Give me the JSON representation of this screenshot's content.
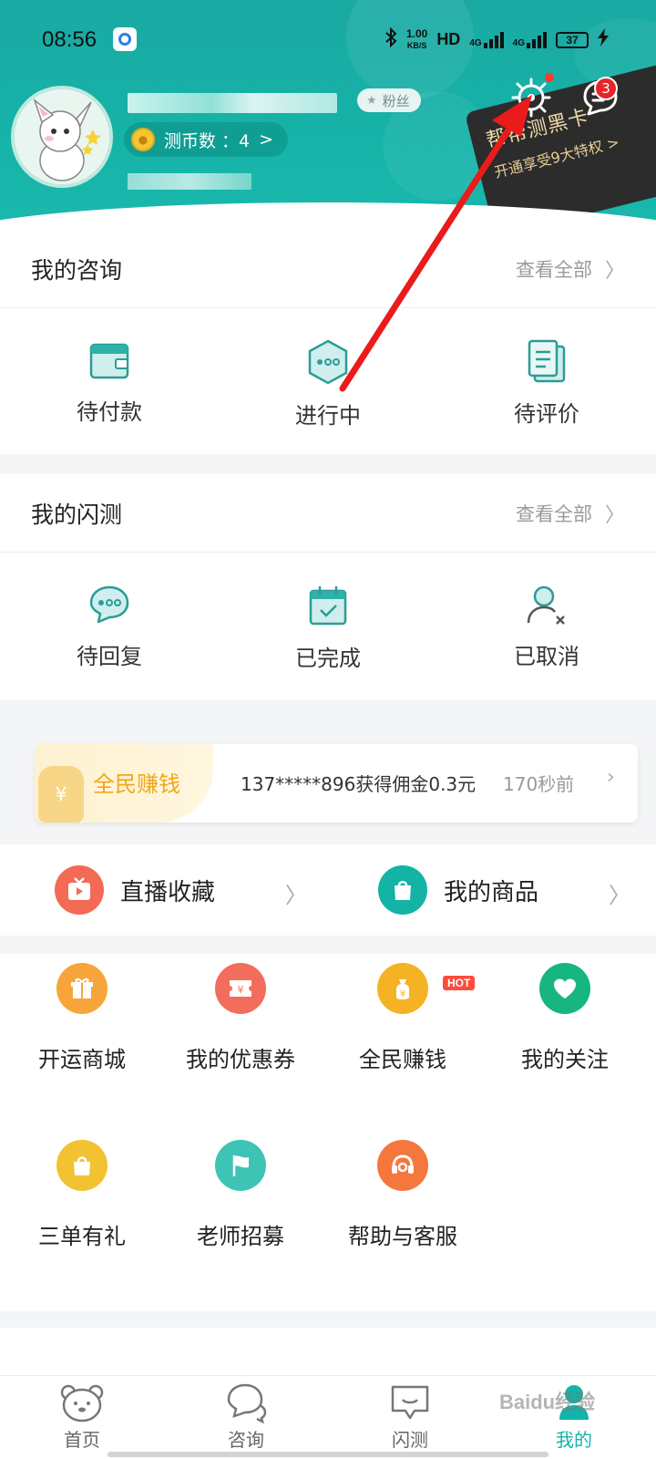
{
  "status_bar": {
    "time": "08:56",
    "net_speed_value": "1.00",
    "net_speed_unit": "KB/S",
    "hd_label": "HD",
    "signal_1": "4G",
    "signal_2": "4G",
    "battery": "37"
  },
  "profile": {
    "fans_label": "粉丝",
    "coin_label": "测币数 ：4",
    "coin_chevron": ">"
  },
  "header": {
    "message_badge": "3",
    "black_card_title": "帮帮测黑卡",
    "black_card_subtitle": "开通享受9大特权 >"
  },
  "consult": {
    "title": "我的咨询",
    "view_all": "查看全部",
    "items": [
      {
        "label": "待付款",
        "icon": "wallet-icon"
      },
      {
        "label": "进行中",
        "icon": "hexagon-dots-icon"
      },
      {
        "label": "待评价",
        "icon": "document-icon"
      }
    ]
  },
  "flash": {
    "title": "我的闪测",
    "view_all": "查看全部",
    "items": [
      {
        "label": "待回复",
        "icon": "chat-bubble-icon"
      },
      {
        "label": "已完成",
        "icon": "calendar-check-icon"
      },
      {
        "label": "已取消",
        "icon": "user-x-icon"
      }
    ]
  },
  "promo": {
    "title": "全民赚钱",
    "text": "137*****896获得佣金0.3元",
    "time": "170秒前"
  },
  "links": {
    "live": "直播收藏",
    "goods": "我的商品"
  },
  "tools": {
    "hot": "HOT",
    "items": [
      {
        "label": "开运商城",
        "color": "#f7a53a",
        "icon": "gift-icon"
      },
      {
        "label": "我的优惠券",
        "color": "#f26d5b",
        "icon": "coupon-icon"
      },
      {
        "label": "全民赚钱",
        "color": "#f5b225",
        "icon": "money-bag-icon"
      },
      {
        "label": "我的关注",
        "color": "#17b580",
        "icon": "heart-icon"
      },
      {
        "label": "三单有礼",
        "color": "#f2c232",
        "icon": "shopping-bag-icon"
      },
      {
        "label": "老师招募",
        "color": "#3ec4b4",
        "icon": "flag-icon"
      },
      {
        "label": "帮助与客服",
        "color": "#f4773d",
        "icon": "headset-icon"
      }
    ]
  },
  "bottom_nav": {
    "items": [
      {
        "label": "首页",
        "icon": "bear-face-icon"
      },
      {
        "label": "咨询",
        "icon": "chat-icon"
      },
      {
        "label": "闪测",
        "icon": "flash-test-icon"
      },
      {
        "label": "我的",
        "icon": "profile-icon"
      }
    ]
  },
  "watermark": "Baidu经验",
  "colors": {
    "brand_teal": "#16b3a8",
    "accent_red": "#e8242a",
    "gold": "#f0a81a"
  }
}
